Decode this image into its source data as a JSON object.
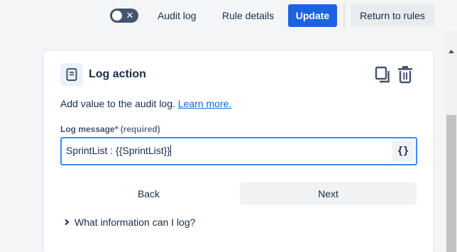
{
  "topbar": {
    "toggle_on": false,
    "audit_log_label": "Audit log",
    "rule_details_label": "Rule details",
    "update_label": "Update",
    "return_label": "Return to rules"
  },
  "card": {
    "icon": "document-icon",
    "title": "Log action",
    "description": "Add value to the audit log.",
    "learn_more": "Learn more.",
    "field": {
      "label": "Log message",
      "required_mark": "*",
      "required_text": "(required)",
      "value": "SprintList : {{SprintList}}",
      "smart_values_label": "{}"
    },
    "back_label": "Back",
    "next_label": "Next",
    "info_label": "What information can I log?"
  },
  "colors": {
    "primary": "#1d63e0",
    "link": "#0c66e4",
    "focus": "#388bff",
    "required": "#c9372c"
  }
}
